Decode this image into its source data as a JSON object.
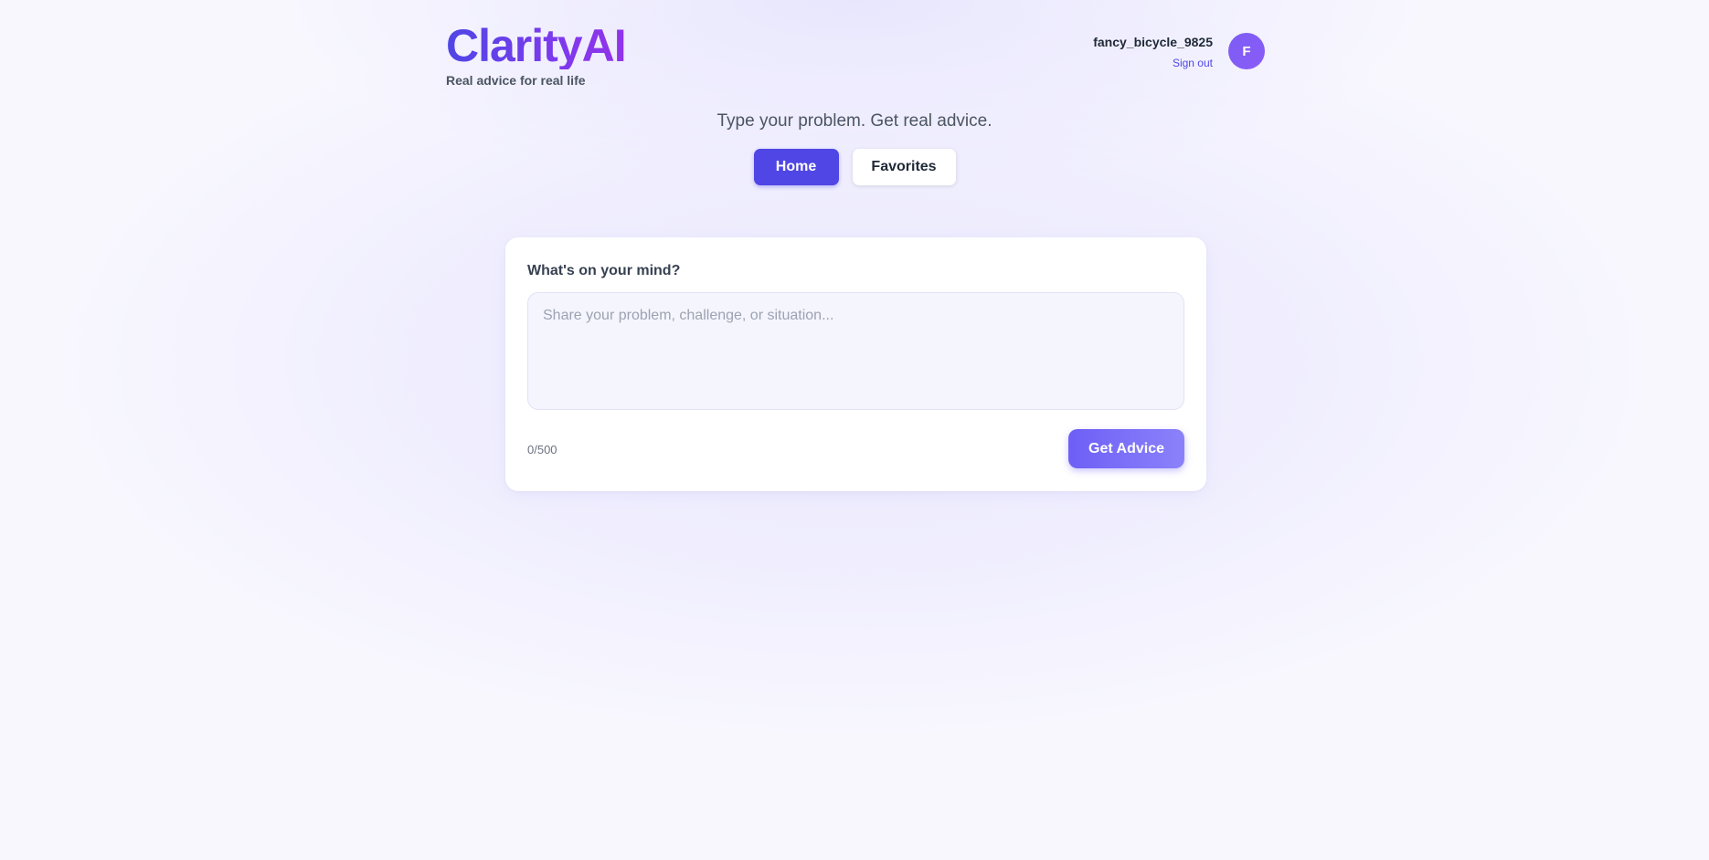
{
  "brand": {
    "name": "ClarityAI",
    "tagline": "Real advice for real life"
  },
  "user": {
    "username": "fancy_bicycle_9825",
    "sign_out_label": "Sign out",
    "avatar_initial": "F"
  },
  "subtitle": "Type your problem. Get real advice.",
  "nav": {
    "home_label": "Home",
    "favorites_label": "Favorites",
    "active": "Home"
  },
  "form": {
    "label": "What's on your mind?",
    "value": "",
    "placeholder": "Share your problem, challenge, or situation...",
    "counter": "0/500",
    "submit_label": "Get Advice"
  },
  "colors": {
    "accent": "#4f46e5",
    "accent_purple": "#7c3aed",
    "background": "#f8f7fe"
  }
}
